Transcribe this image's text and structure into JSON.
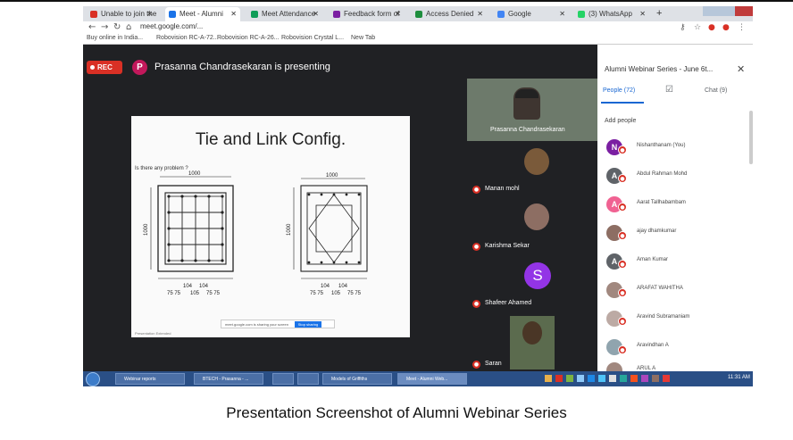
{
  "browser": {
    "tabs": [
      {
        "label": "Unable to join the",
        "color": "#d93025"
      },
      {
        "label": "Meet - Alumni",
        "color": "#1a73e8",
        "active": true
      },
      {
        "label": "Meet Attendance",
        "color": "#0f9d58"
      },
      {
        "label": "Feedback form of",
        "color": "#7b1fa2"
      },
      {
        "label": "Access Denied",
        "color": "#1e8e3e"
      },
      {
        "label": "Google",
        "color": "#4285f4"
      },
      {
        "label": "(3) WhatsApp",
        "color": "#25d366"
      }
    ],
    "new_tab": "+",
    "url": "meet.google.com/...",
    "bookmarks": [
      "Buy online in India...",
      "Robovision RC-A-72...",
      "Robovision RC-A-26...",
      "Robovision Crystal L...",
      "New Tab"
    ]
  },
  "meet": {
    "rec_label": "REC",
    "presenter_initial": "P",
    "presenting_text": "Prasanna Chandrasekaran is presenting",
    "slide": {
      "title": "Tie and Link Config.",
      "question": "Is there any problem ?",
      "share_notice": "meet.google.com is sharing your screen",
      "stop_label": "Stop sharing",
      "footer": "Presentation Extended"
    },
    "tiles": [
      {
        "name": "Prasanna Chandrasekaran"
      },
      {
        "name": "Manan mohl"
      },
      {
        "name": "Karishma Sekar"
      },
      {
        "name": "Shafeer Ahamed",
        "initial": "S"
      },
      {
        "name": "Saran"
      }
    ]
  },
  "panel": {
    "title": "Alumni Webinar Series - June 6t...",
    "close": "✕",
    "tab_people": "People (72)",
    "tab_chat": "Chat (9)",
    "add_people": "Add people",
    "participants": [
      {
        "initial": "N",
        "color": "#7b1fa2",
        "name": "Nishanthanam (You)"
      },
      {
        "initial": "A",
        "color": "#5f6368",
        "name": "Abdul Rahman Mohd"
      },
      {
        "initial": "A",
        "color": "#f06292",
        "name": "Aarat Tallhabambam"
      },
      {
        "initial": "",
        "color": "#8d6e63",
        "name": "ajay dhamkumar"
      },
      {
        "initial": "A",
        "color": "#5f6368",
        "name": "Aman Kumar"
      },
      {
        "initial": "",
        "color": "#a1887f",
        "name": "ARAFAT WAHITHA"
      },
      {
        "initial": "",
        "color": "#bcaaa4",
        "name": "Aravind Subramaniam"
      },
      {
        "initial": "",
        "color": "#90a4ae",
        "name": "Aravindhan A"
      },
      {
        "initial": "",
        "color": "#a1887f",
        "name": "ARUL A"
      }
    ]
  },
  "taskbar": {
    "buttons": [
      "Webinar reports",
      "BTECH - Prasanna - ...",
      "",
      "",
      "Models of Griffiths",
      "Meet - Alumni Web..."
    ],
    "clock": "11:31 AM"
  },
  "caption": "Presentation Screenshot of Alumni Webinar Series"
}
